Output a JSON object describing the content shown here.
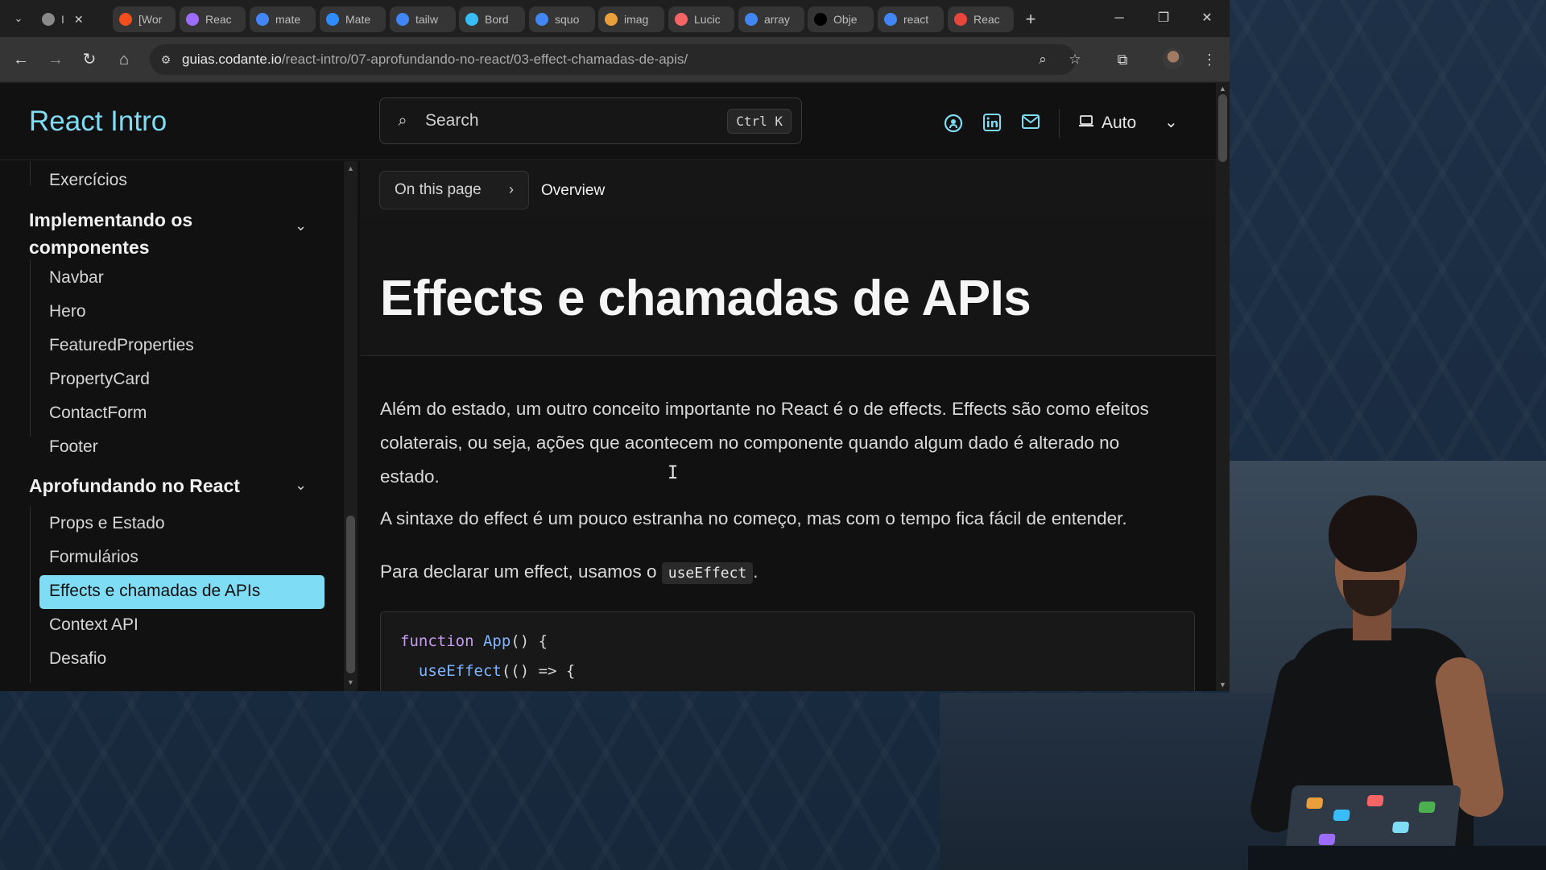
{
  "tabs": [
    {
      "label": "I",
      "icon": "chrome-icon",
      "color": "#8a8a8a",
      "active": true
    },
    {
      "label": "[Wor",
      "icon": "figma-icon",
      "color": "#f24e1e"
    },
    {
      "label": "Reac",
      "icon": "vite-icon",
      "color": "#9c6cff"
    },
    {
      "label": "mate",
      "icon": "google-icon",
      "color": "#4285f4"
    },
    {
      "label": "Mate",
      "icon": "mui-icon",
      "color": "#2f8cff"
    },
    {
      "label": "tailw",
      "icon": "google-icon",
      "color": "#4285f4"
    },
    {
      "label": "Bord",
      "icon": "tailwind-icon",
      "color": "#38bdf8"
    },
    {
      "label": "squo",
      "icon": "google-icon",
      "color": "#4285f4"
    },
    {
      "label": "imag",
      "icon": "image-icon",
      "color": "#e9a03b"
    },
    {
      "label": "Lucic",
      "icon": "lucide-icon",
      "color": "#f56565"
    },
    {
      "label": "array",
      "icon": "google-icon",
      "color": "#4285f4"
    },
    {
      "label": "Obje",
      "icon": "mdn-icon",
      "color": "#000000"
    },
    {
      "label": "react",
      "icon": "google-icon",
      "color": "#4285f4"
    },
    {
      "label": "Reac",
      "icon": "slides-icon",
      "color": "#e8453c"
    }
  ],
  "toolbar": {
    "url_host": "guias.codante.io",
    "url_path": "/react-intro/07-aprofundando-no-react/03-effect-chamadas-de-apis/"
  },
  "site": {
    "brand": "React Intro",
    "search_placeholder": "Search",
    "search_shortcut": "Ctrl K",
    "theme_label": "Auto",
    "accent": "#7fdcf5"
  },
  "sidebar": {
    "top_item": "Exercícios",
    "group1": {
      "title_line1": "Implementando os",
      "title_line2": "componentes",
      "items": [
        "Navbar",
        "Hero",
        "FeaturedProperties",
        "PropertyCard",
        "ContactForm",
        "Footer"
      ]
    },
    "group2": {
      "title": "Aprofundando no React",
      "items": [
        "Props e Estado",
        "Formulários",
        "Effects e chamadas de APIs",
        "Context API",
        "Desafio"
      ],
      "active_index": 2
    }
  },
  "toc": {
    "button_label": "On this page",
    "current": "Overview"
  },
  "article": {
    "title": "Effects e chamadas de APIs",
    "p1_line1": "Além do estado, um outro conceito importante no React é o de effects. Effects são como efeitos",
    "p1_line2": "colaterais, ou seja, ações que acontecem no componente quando algum dado é alterado no",
    "p1_line3": "estado.",
    "p2": "A sintaxe do effect é um pouco estranha no começo, mas com o tempo fica fácil de entender.",
    "p3_before": "Para declarar um effect, usamos o ",
    "p3_code": "useEffect",
    "p3_after": ".",
    "code": {
      "line1_kw": "function",
      "line1_fn": "App",
      "line1_rest": "() {",
      "line2_fn": "useEffect",
      "line2_rest": "(() => {"
    }
  }
}
